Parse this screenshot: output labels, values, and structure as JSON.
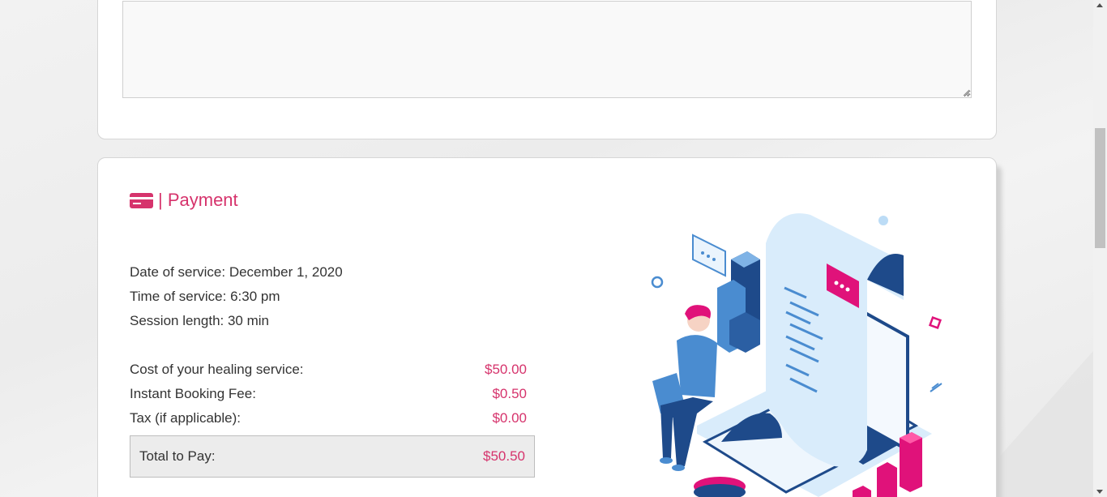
{
  "comments": {
    "value": ""
  },
  "payment": {
    "heading": "| Payment",
    "date_of_service": "Date of service: December 1, 2020",
    "time_of_service": "Time of service: 6:30 pm",
    "session_length": "Session length: 30 min",
    "fees": [
      {
        "label": "Cost of your healing service:",
        "amount": "$50.00"
      },
      {
        "label": "Instant Booking Fee:",
        "amount": "$0.50"
      },
      {
        "label": "Tax (if applicable):",
        "amount": "$0.00"
      }
    ],
    "total": {
      "label": "Total to Pay:",
      "amount": "$50.50"
    }
  },
  "colors": {
    "accent": "#d6336c",
    "illustration_blue": "#1e4a8a",
    "illustration_light": "#d9ecfb"
  },
  "icons": {
    "payment": "credit-card-icon",
    "illustration": "person-with-laptop-receipt-illustration"
  }
}
